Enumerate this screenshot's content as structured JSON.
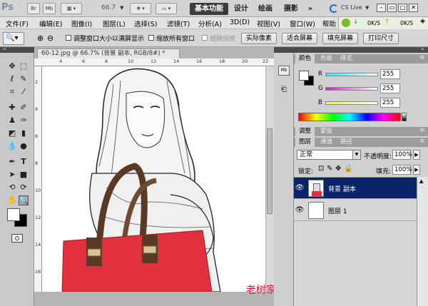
{
  "appbar": {
    "logo": "Ps",
    "btn_br": "Br",
    "btn_mb": "Mb",
    "zoom": "66.7",
    "workspaces": [
      "基本功能",
      "设计",
      "绘画",
      "摄影"
    ],
    "more": "»",
    "cslive": "CS Live",
    "net_down": "0K/S",
    "net_up": "0K/S"
  },
  "menu": {
    "items": [
      "文件(F)",
      "编辑(E)",
      "图像(I)",
      "图层(L)",
      "选择(S)",
      "滤镜(T)",
      "分析(A)",
      "3D(D)",
      "视图(V)",
      "窗口(W)",
      "帮助"
    ]
  },
  "options": {
    "resize_label": "调整窗口大小以满屏显示",
    "zoom_all_label": "缩放所有窗口",
    "scrubby_label": "细微缩放",
    "actual_pixels": "实际像素",
    "fit_screen": "适合屏幕",
    "fill_screen": "填充屏幕",
    "print_size": "打印尺寸"
  },
  "document": {
    "tab_title": "60-12.jpg @ 66.7% (背景 副本, RGB/8#) *",
    "ruler_h": [
      "4",
      "6",
      "8",
      "10",
      "12",
      "14",
      "16",
      "18",
      "20",
      "22"
    ],
    "ruler_v": [
      "2",
      "4",
      "6",
      "8",
      "10",
      "12",
      "14",
      "16"
    ]
  },
  "color_panel": {
    "tabs": [
      "颜色",
      "色板",
      "样式"
    ],
    "r_label": "R",
    "g_label": "G",
    "b_label": "B",
    "r": "255",
    "g": "255",
    "b": "255"
  },
  "adjust_panel": {
    "tabs": [
      "调整",
      "蒙版"
    ]
  },
  "layers_panel": {
    "tabs": [
      "图层",
      "通道",
      "路径"
    ],
    "blend_mode": "正常",
    "opacity_label": "不透明度:",
    "opacity": "100%",
    "lock_label": "锁定:",
    "fill_label": "填充:",
    "fill": "100%",
    "layers": [
      {
        "name": "背景 副本",
        "selected": true
      },
      {
        "name": "图层 1",
        "selected": false
      }
    ]
  },
  "watermark": "老树家电网",
  "colors": {
    "accent": "#0a246a",
    "watermark": "#e0163a",
    "bag": "#e2303c"
  }
}
